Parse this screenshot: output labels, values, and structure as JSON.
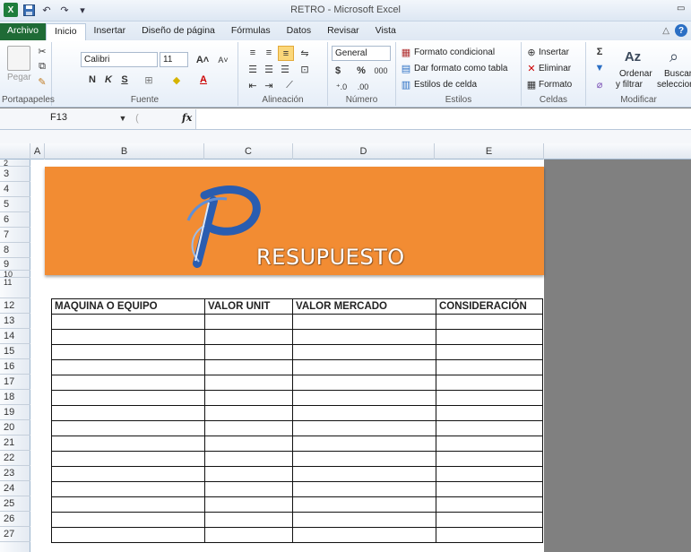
{
  "window": {
    "title": "RETRO  -  Microsoft Excel"
  },
  "ribbon_tabs": [
    "Archivo",
    "Inicio",
    "Insertar",
    "Diseño de página",
    "Fórmulas",
    "Datos",
    "Revisar",
    "Vista"
  ],
  "ribbon": {
    "clipboard": {
      "paste": "Pegar",
      "label": "Portapapeles"
    },
    "font": {
      "name": "Calibri",
      "size": "11",
      "bold": "N",
      "italic": "K",
      "underline": "S",
      "label": "Fuente"
    },
    "alignment": {
      "label": "Alineación"
    },
    "number": {
      "format": "General",
      "currency": "$",
      "percent": "%",
      "thousands": "000",
      "label": "Número"
    },
    "styles": {
      "conditional": "Formato condicional",
      "as_table": "Dar formato como tabla",
      "cell_styles": "Estilos de celda",
      "label": "Estilos"
    },
    "cells": {
      "insert": "Insertar",
      "delete": "Eliminar",
      "format": "Formato",
      "label": "Celdas"
    },
    "editing": {
      "sum": "Σ",
      "sort_filter_1": "Ordenar",
      "sort_filter_2": "y filtrar",
      "find_1": "Buscar",
      "find_2": "seleccion",
      "label": "Modificar"
    }
  },
  "formula_bar": {
    "name_box": "F13",
    "fx": "fx",
    "value": ""
  },
  "columns": [
    "A",
    "B",
    "C",
    "D",
    "E"
  ],
  "rows": [
    "2",
    "3",
    "4",
    "5",
    "6",
    "7",
    "8",
    "9",
    "10",
    "11",
    "12",
    "13",
    "14",
    "15",
    "16",
    "17",
    "18",
    "19",
    "20",
    "21",
    "22",
    "23",
    "24",
    "25",
    "26",
    "27"
  ],
  "banner": {
    "letter": "P",
    "title": "RESUPUESTO"
  },
  "table": {
    "headers": [
      "MAQUINA O EQUIPO",
      "VALOR UNIT",
      "VALOR MERCADO",
      "CONSIDERACIÓN"
    ],
    "empty_rows": 15
  },
  "colors": {
    "banner": "#f28c33",
    "file_tab": "#1f6b36",
    "logo_blue": "#2a5db0"
  }
}
